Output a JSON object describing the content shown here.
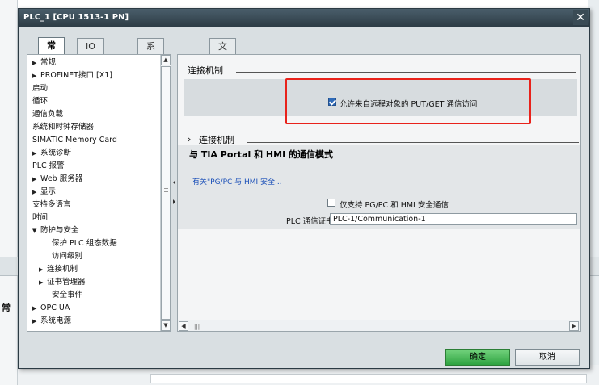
{
  "dialog": {
    "title": "PLC_1 [CPU 1513-1 PN]",
    "close_glyph": "✕"
  },
  "tabs": [
    {
      "label": "常规",
      "active": true
    },
    {
      "label": "IO 变量",
      "active": false
    },
    {
      "label": "系统常数",
      "active": false
    },
    {
      "label": "文本",
      "active": false
    }
  ],
  "nav": {
    "items": [
      {
        "label": "常规",
        "arrow": "▶",
        "level": 0
      },
      {
        "label": "PROFINET接口 [X1]",
        "arrow": "▶",
        "level": 0
      },
      {
        "label": "启动",
        "arrow": "",
        "level": 0
      },
      {
        "label": "循环",
        "arrow": "",
        "level": 0
      },
      {
        "label": "通信负载",
        "arrow": "",
        "level": 0
      },
      {
        "label": "系统和时钟存储器",
        "arrow": "",
        "level": 0
      },
      {
        "label": "SIMATIC Memory Card",
        "arrow": "",
        "level": 0
      },
      {
        "label": "系统诊断",
        "arrow": "▶",
        "level": 0
      },
      {
        "label": "PLC 报警",
        "arrow": "",
        "level": 0
      },
      {
        "label": "Web 服务器",
        "arrow": "▶",
        "level": 0
      },
      {
        "label": "显示",
        "arrow": "▶",
        "level": 0
      },
      {
        "label": "支持多语言",
        "arrow": "",
        "level": 0
      },
      {
        "label": "时间",
        "arrow": "",
        "level": 0
      },
      {
        "label": "防护与安全",
        "arrow": "▼",
        "level": 0
      },
      {
        "label": "保护 PLC 组态数据",
        "arrow": "",
        "level": 2
      },
      {
        "label": "访问级别",
        "arrow": "",
        "level": 2
      },
      {
        "label": "连接机制",
        "arrow": "▶",
        "level": 1
      },
      {
        "label": "证书管理器",
        "arrow": "▶",
        "level": 1
      },
      {
        "label": "安全事件",
        "arrow": "",
        "level": 2
      },
      {
        "label": "OPC UA",
        "arrow": "▶",
        "level": 0
      },
      {
        "label": "系统电源",
        "arrow": "▶",
        "level": 0
      }
    ]
  },
  "content": {
    "section1_title": "连接机制",
    "putget_checkbox_label": "允许来自远程对象的 PUT/GET 通信访问",
    "putget_checked": true,
    "section2_arrow": "›",
    "section2_title": "连接机制",
    "section3_title": "与 TIA Portal 和 HMI 的通信模式",
    "security_link": "有关\"PG/PC 与 HMI 安全...",
    "secure_only_label": "仅支持 PG/PC 和 HMI 安全通信",
    "secure_only_checked": false,
    "cert_label": "PLC 通信证书：",
    "cert_value": "PLC-1/Communication-1"
  },
  "footer": {
    "ok_label": "确定",
    "cancel_label": "取消"
  },
  "background": {
    "left_label": "常"
  },
  "colors": {
    "highlight_border": "#e8221b",
    "ok_button": "#2fa341",
    "link": "#1a4fb8"
  }
}
